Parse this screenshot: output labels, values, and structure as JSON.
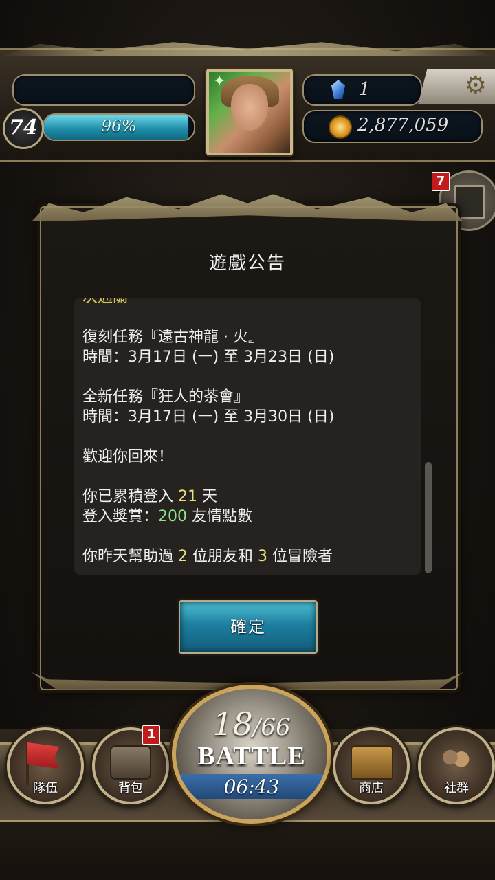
{
  "hud": {
    "level": "74",
    "exp_percent_label": "96%",
    "exp_fraction": 0.96,
    "gems": "1",
    "gold": "2,877,059",
    "icons": [
      "settings-gear-icon",
      "gem-icon",
      "gold-coin-icon",
      "character-portrait"
    ]
  },
  "notifications": {
    "count": "7",
    "icon": "notice-list-icon"
  },
  "dialog": {
    "title": "遊戲公告",
    "notice": {
      "clipped_top": "次通關",
      "rerun_title": "復刻任務『遠古神龍 · 火』",
      "rerun_time": "時間：3月17日 (一) 至 3月23日 (日)",
      "new_title": "全新任務『狂人的茶會』",
      "new_time": "時間：3月17日 (一) 至 3月30日 (日)",
      "welcome": "歡迎你回來！",
      "login_days_prefix": "你已累積登入 ",
      "login_days": "21",
      "login_days_suffix": " 天",
      "reward_prefix": "登入獎賞：",
      "reward_amount": "200",
      "reward_suffix": " 友情點數",
      "helped_prefix": "你昨天幫助過 ",
      "helped_friends": "2",
      "helped_middle": " 位朋友和 ",
      "helped_adventurers": "3",
      "helped_suffix": " 位冒險者"
    },
    "confirm_label": "確定"
  },
  "nav": {
    "team_label": "隊伍",
    "bag_label": "背包",
    "bag_badge": "1",
    "battle_current": "18",
    "battle_max": "/66",
    "battle_label": "BATTLE",
    "battle_timer": "06:43",
    "shop_label": "商店",
    "social_label": "社群"
  },
  "colors": {
    "highlight_number": "#e8e27a",
    "reward_number": "#8fe38a",
    "button_teal": "#1e7fa0",
    "badge_red": "#c21b1b"
  }
}
